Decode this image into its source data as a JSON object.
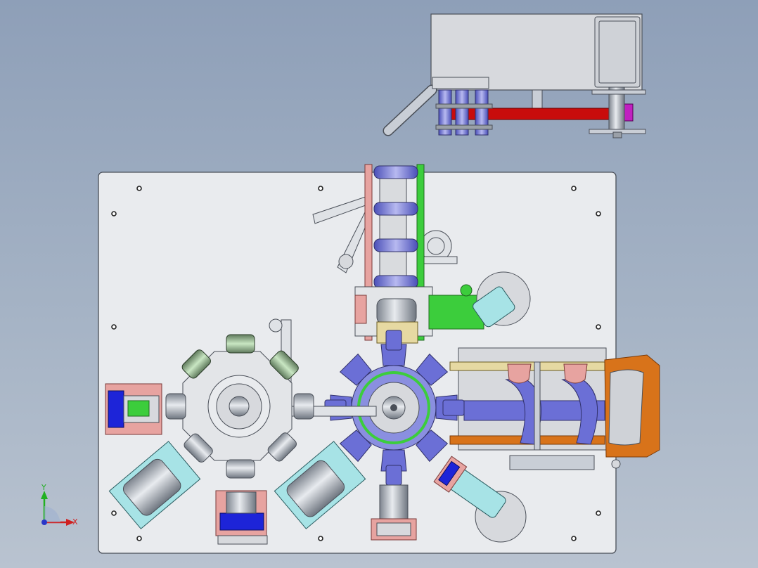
{
  "colors": {
    "plate": "#e9ebee",
    "plate_edge": "#4a4f58",
    "housing": "#d7d9dd",
    "steel": "#c9ced6",
    "steel_dark": "#8b929c",
    "blue_part": "#6b6fd6",
    "deep_blue": "#1d24d8",
    "red_bar": "#c80c0c",
    "magenta": "#c020c0",
    "green": "#3ccd3c",
    "pale_green": "#a8d8a0",
    "pink": "#e7a3a0",
    "cyan": "#a7e3e6",
    "orange": "#d8731a",
    "tan": "#e6d9a2",
    "gray_green": "#8fa88c"
  },
  "triad": {
    "y_label": "Y",
    "x_label": "X",
    "y_color": "#22b022",
    "x_color": "#d02020",
    "origin_color": "#2a36c8"
  }
}
